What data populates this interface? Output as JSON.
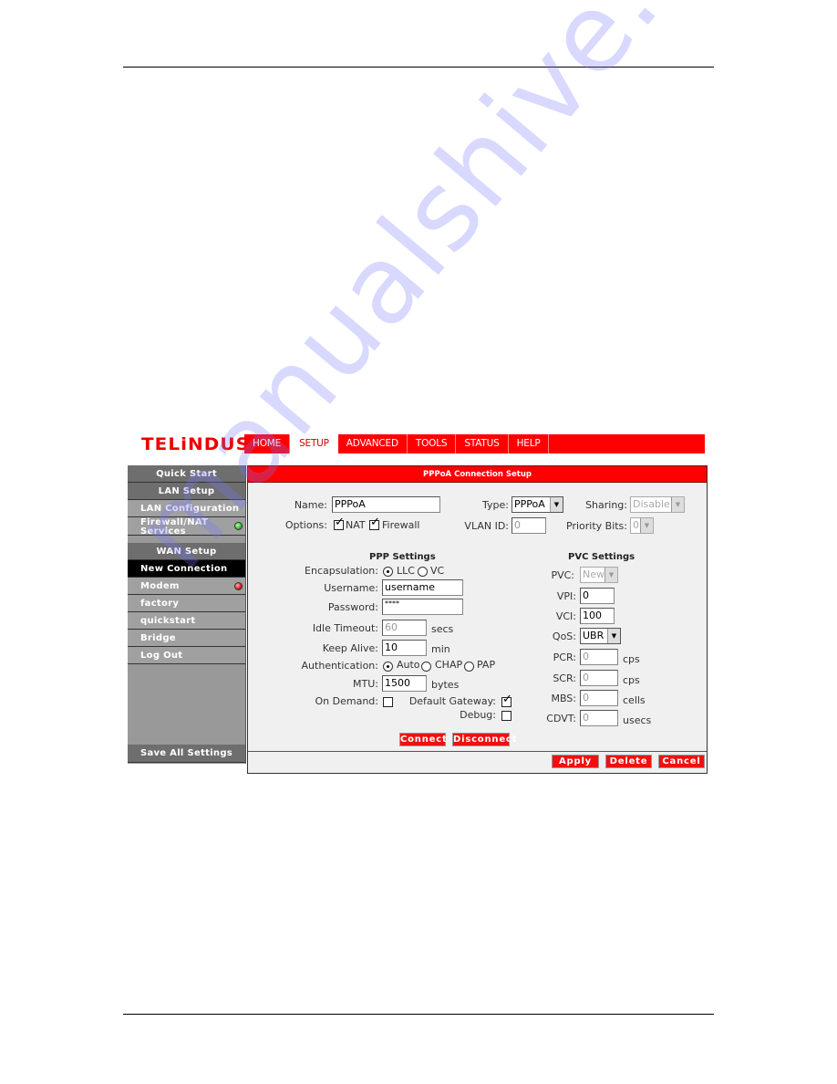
{
  "watermark": "manualshive.com",
  "brand": {
    "logo": "TELiNDUS",
    "color": "#ee0000"
  },
  "nav": {
    "tabs": [
      {
        "label": "HOME",
        "active": false
      },
      {
        "label": "SETUP",
        "active": true
      },
      {
        "label": "ADVANCED",
        "active": false
      },
      {
        "label": "TOOLS",
        "active": false
      },
      {
        "label": "STATUS",
        "active": false
      },
      {
        "label": "HELP",
        "active": false
      }
    ]
  },
  "sidebar": {
    "quick_start": "Quick Start",
    "lan_setup": "LAN Setup",
    "lan_configuration": "LAN Configuration",
    "firewall_nat_line1": "Firewall/NAT",
    "firewall_nat_line2": "Services",
    "firewall_status": "green",
    "wan_setup": "WAN Setup",
    "new_connection": "New Connection",
    "modem": "Modem",
    "modem_status": "red",
    "factory": "factory",
    "quickstart": "quickstart",
    "bridge": "Bridge",
    "log_out": "Log Out",
    "save_all": "Save All Settings"
  },
  "panel": {
    "title": "PPPoA Connection Setup",
    "name_label": "Name:",
    "name_value": "PPPoA",
    "type_label": "Type:",
    "type_value": "PPPoA",
    "sharing_label": "Sharing:",
    "sharing_value": "Disable",
    "options_label": "Options:",
    "nat_label": "NAT",
    "nat_checked": true,
    "firewall_label": "Firewall",
    "firewall_checked": true,
    "vlan_label": "VLAN ID:",
    "vlan_value": "0",
    "priority_label": "Priority Bits:",
    "priority_value": "0",
    "ppp": {
      "title": "PPP Settings",
      "encapsulation_label": "Encapsulation:",
      "encap_llc": "LLC",
      "encap_vc": "VC",
      "encap_selected": "LLC",
      "username_label": "Username:",
      "username_value": "username",
      "password_label": "Password:",
      "password_value": "****",
      "idle_label": "Idle Timeout:",
      "idle_value": "60",
      "idle_unit": "secs",
      "keepalive_label": "Keep Alive:",
      "keepalive_value": "10",
      "keepalive_unit": "min",
      "auth_label": "Authentication:",
      "auth_auto": "Auto",
      "auth_chap": "CHAP",
      "auth_pap": "PAP",
      "auth_selected": "Auto",
      "mtu_label": "MTU:",
      "mtu_value": "1500",
      "mtu_unit": "bytes",
      "ondemand_label": "On Demand:",
      "ondemand_checked": false,
      "gateway_label": "Default Gateway:",
      "gateway_checked": true,
      "debug_label": "Debug:",
      "debug_checked": false
    },
    "pvc": {
      "title": "PVC Settings",
      "pvc_label": "PVC:",
      "pvc_value": "New",
      "vpi_label": "VPI:",
      "vpi_value": "0",
      "vci_label": "VCI:",
      "vci_value": "100",
      "qos_label": "QoS:",
      "qos_value": "UBR",
      "pcr_label": "PCR:",
      "pcr_value": "0",
      "pcr_unit": "cps",
      "scr_label": "SCR:",
      "scr_value": "0",
      "scr_unit": "cps",
      "mbs_label": "MBS:",
      "mbs_value": "0",
      "mbs_unit": "cells",
      "cdvt_label": "CDVT:",
      "cdvt_value": "0",
      "cdvt_unit": "usecs"
    },
    "buttons": {
      "connect": "Connect",
      "disconnect": "Disconnect",
      "apply": "Apply",
      "delete": "Delete",
      "cancel": "Cancel"
    }
  }
}
